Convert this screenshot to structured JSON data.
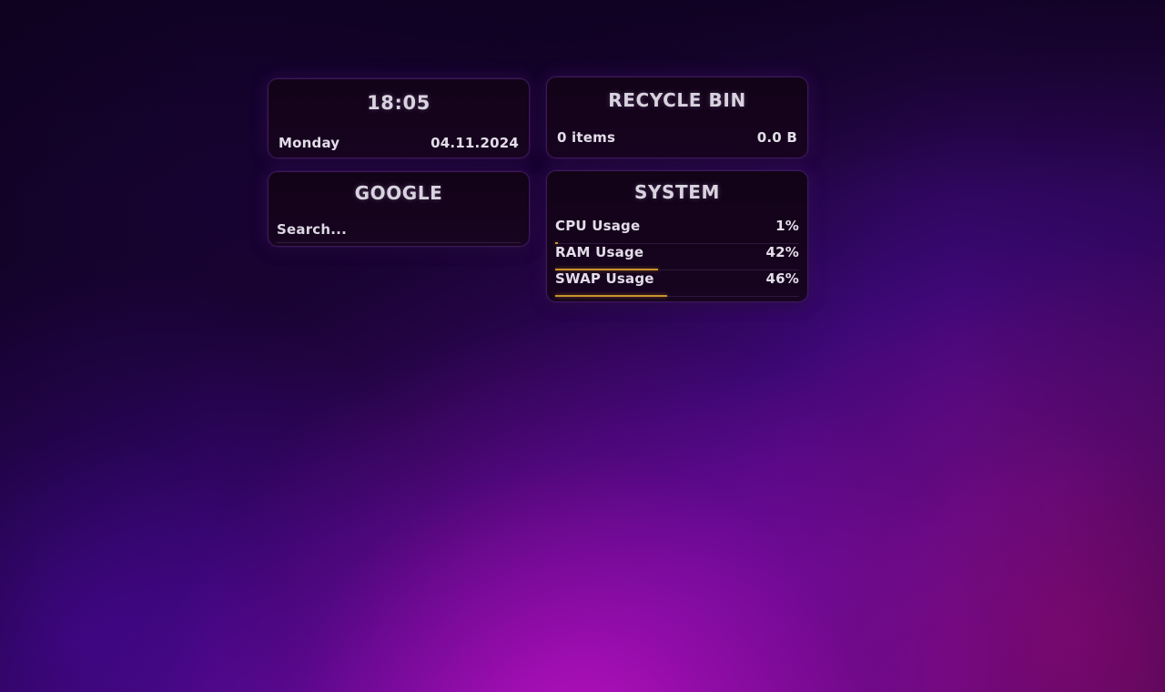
{
  "desktop": {
    "accent_amber": "#c8922a",
    "widget_background": "#130318",
    "widget_border": "#803ebe",
    "text_color": "#e2dde8"
  },
  "widgets": {
    "clock": {
      "title": "18:05",
      "weekday": "Monday",
      "date": "04.11.2024"
    },
    "recycle_bin": {
      "title": "RECYCLE BIN",
      "item_count": "0 items",
      "size": "0.0 B"
    },
    "google": {
      "title": "GOOGLE",
      "search_placeholder": "Search...",
      "search_value": ""
    },
    "system": {
      "title": "SYSTEM",
      "rows": [
        {
          "label": "CPU Usage",
          "value": "1%",
          "percent": 1
        },
        {
          "label": "RAM Usage",
          "value": "42%",
          "percent": 42
        },
        {
          "label": "SWAP Usage",
          "value": "46%",
          "percent": 46
        }
      ]
    }
  }
}
